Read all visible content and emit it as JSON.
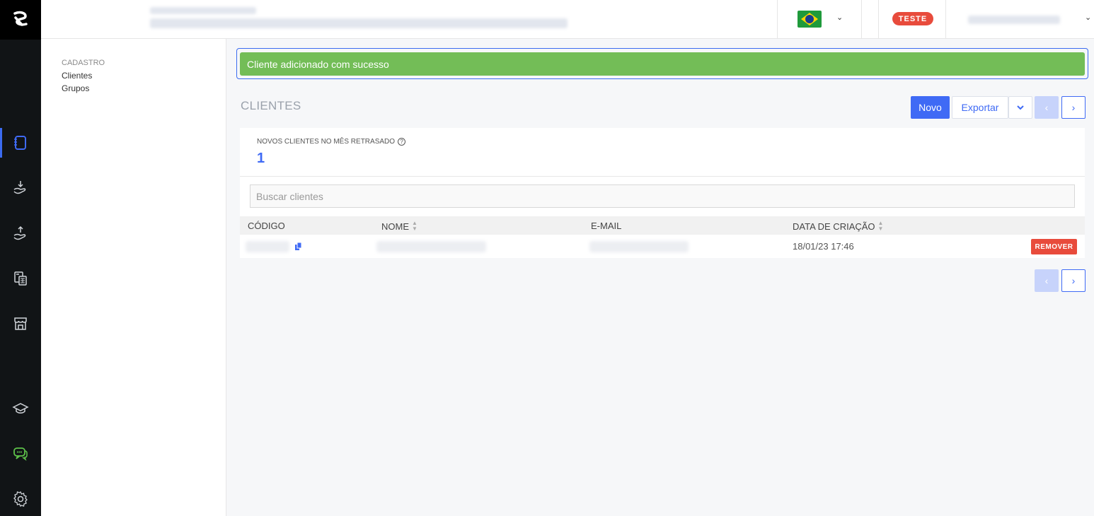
{
  "header": {
    "env_badge": "TESTE",
    "language_flag": "brazil-flag-icon"
  },
  "sidebar": {
    "section": "CADASTRO",
    "items": [
      {
        "label": "Clientes"
      },
      {
        "label": "Grupos"
      }
    ]
  },
  "rail": {
    "icons": [
      "logo-icon",
      "notebook-icon",
      "hand-receive-icon",
      "hand-send-icon",
      "calculator-icon",
      "store-icon",
      "graduation-cap-icon",
      "chat-icon",
      "gear-icon"
    ]
  },
  "alert": {
    "message": "Cliente adicionado com sucesso"
  },
  "page": {
    "title": "CLIENTES",
    "new_label": "Novo",
    "export_label": "Exportar",
    "caret": "⌄",
    "prev": "‹",
    "next": "›"
  },
  "stats": {
    "label": "NOVOS CLIENTES NO MÊS RETRASADO",
    "value": "1",
    "help": "?"
  },
  "search": {
    "placeholder": "Buscar clientes"
  },
  "table": {
    "headers": [
      "CÓDIGO",
      "NOME",
      "E-MAIL",
      "DATA DE CRIAÇÃO"
    ],
    "rows": [
      {
        "created": "18/01/23 17:46",
        "remove_label": "REMOVER"
      }
    ]
  },
  "colors": {
    "primary": "#3f6af5",
    "success": "#73bd57",
    "danger": "#e84b3c",
    "rail": "#111416"
  }
}
